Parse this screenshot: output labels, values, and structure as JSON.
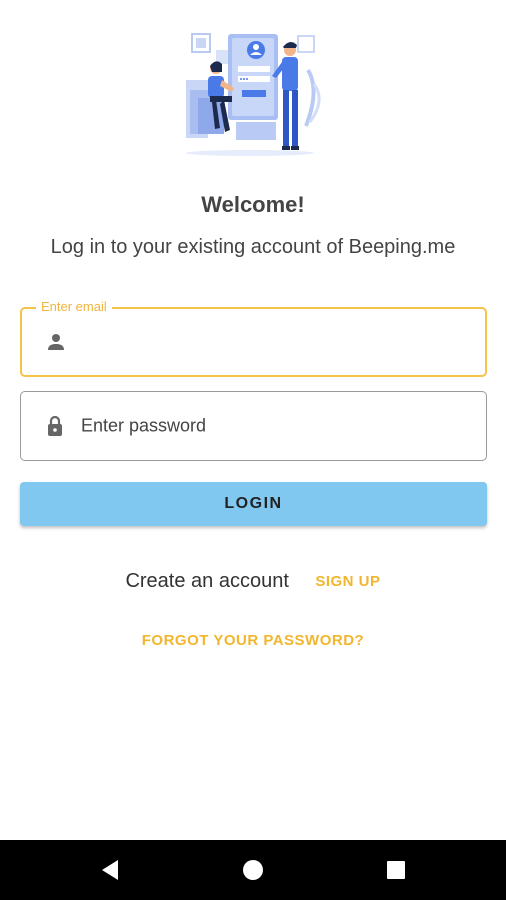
{
  "welcome": {
    "title": "Welcome!",
    "subtitle": "Log in to your existing account of Beeping.me",
    "illustration": "person-login-illustration"
  },
  "email_field": {
    "label": "Enter email",
    "value": "",
    "icon": "person-icon"
  },
  "password_field": {
    "placeholder": "Enter password",
    "value": "",
    "icon": "lock-icon"
  },
  "login_button": {
    "label": "LOGIN"
  },
  "signup": {
    "prompt": "Create an account",
    "link_label": "SIGN UP"
  },
  "forgot_password": {
    "label": "FORGOT YOUR PASSWORD?"
  },
  "navigation_bar": {
    "back": "back-triangle-icon",
    "home": "home-circle-icon",
    "recents": "recents-square-icon"
  },
  "colors": {
    "accent": "#f2b62e",
    "login_button_bg": "#80c8f0",
    "illustration_blue": "#4a79e8"
  }
}
